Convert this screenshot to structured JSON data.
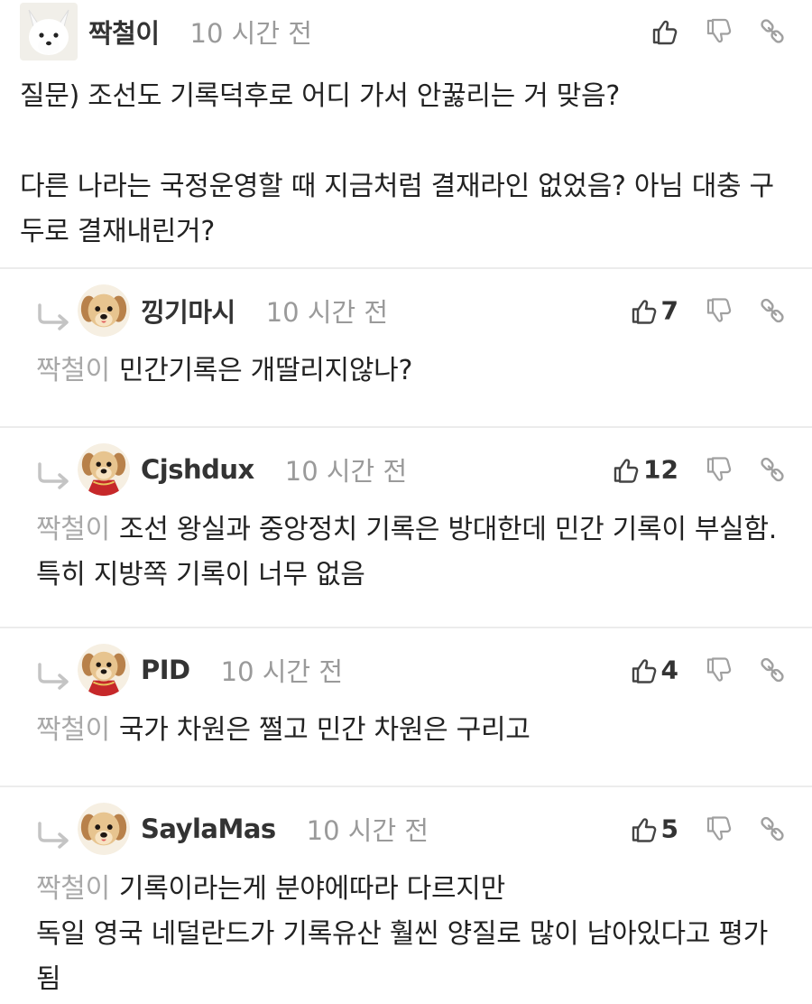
{
  "main_comment": {
    "username": "짝철이",
    "time": "10 시간 전",
    "avatar_icon": "white-fox-avatar",
    "text": "질문) 조선도 기록덕후로 어디 가서 안꿇리는 거 맞음?\n\n다른 나라는 국정운영할 때 지금처럼 결재라인 없었음? 아님 대충 구두로 결재내린거?"
  },
  "replies": [
    {
      "username": "낑기마시",
      "time": "10 시간 전",
      "likes": "7",
      "avatar_icon": "puppy-avatar",
      "mention": "짝철이",
      "text": "민간기록은 개딸리지않나?"
    },
    {
      "username": "Cjshdux",
      "time": "10 시간 전",
      "likes": "12",
      "avatar_icon": "puppy-cape-avatar",
      "mention": "짝철이",
      "text": "조선 왕실과 중앙정치 기록은 방대한데 민간 기록이 부실함. 특히 지방쪽 기록이 너무 없음"
    },
    {
      "username": "PID",
      "time": "10 시간 전",
      "likes": "4",
      "avatar_icon": "puppy-cape-avatar",
      "mention": "짝철이",
      "text": "국가 차원은 쩔고 민간 차원은 구리고"
    },
    {
      "username": "SaylaMas",
      "time": "10 시간 전",
      "likes": "5",
      "avatar_icon": "puppy-avatar",
      "mention": "짝철이",
      "text": "기록이라는게 분야에따라 다르지만\n독일 영국 네덜란드가 기록유산 훨씬 양질로 많이 남아있다고 평가됨"
    }
  ],
  "colors": {
    "text": "#222222",
    "muted": "#9a9a9a",
    "mention": "#a8a8a8",
    "divider": "#ececec",
    "icon": "#555555"
  }
}
